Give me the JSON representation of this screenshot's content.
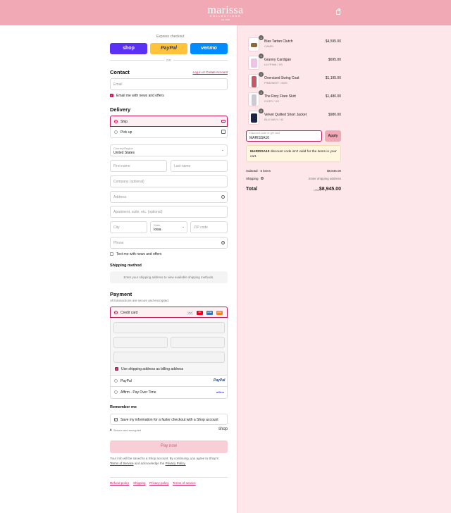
{
  "header": {
    "brand": "marissa",
    "brand_sub": "COLLECTIONS",
    "brand_est": "est. 1996",
    "cart_icon": "shopping-bag-icon"
  },
  "express": {
    "title": "Express checkout",
    "shop": "shop",
    "paypal": "PayPal",
    "venmo": "venmo",
    "or": "OR"
  },
  "contact": {
    "title": "Contact",
    "login_link": "Log in or Create Account",
    "email_placeholder": "Email",
    "newsletter": "Email me with news and offers"
  },
  "delivery": {
    "title": "Delivery",
    "ship": "Ship",
    "pickup": "Pick up",
    "country_label": "Country/Region",
    "country_value": "United States",
    "first_name": "First name",
    "last_name": "Last name",
    "company": "Company (optional)",
    "address": "Address",
    "apartment": "Apartment, suite, etc. (optional)",
    "city": "City",
    "state_label": "State",
    "state_value": "Iowa",
    "zip": "ZIP code",
    "phone": "Phone",
    "text_offers": "Text me with news and offers"
  },
  "shipping_method": {
    "title": "Shipping method",
    "placeholder": "Enter your shipping address to view available shipping methods."
  },
  "payment": {
    "title": "Payment",
    "subtitle": "All transactions are secure and encrypted.",
    "credit_card": "Credit card",
    "billing_same": "Use shipping address as billing address",
    "paypal": "PayPal",
    "affirm": "Affirm - Pay Over Time",
    "card_brands": [
      "VISA",
      "MC",
      "AMEX",
      "DISC"
    ]
  },
  "remember": {
    "title": "Remember me",
    "save_info": "Save my information for a faster checkout with a Shop account",
    "secure": "Secure and encrypted",
    "shop": "shop"
  },
  "pay_button": "Pay now",
  "legal": {
    "text1": "Your info will be saved to a Shop account. By continuing, you agree to Shop's",
    "terms": "Terms of Service",
    "text2": "and acknowledge the",
    "privacy": "Privacy Policy."
  },
  "footer_links": [
    "Refund policy",
    "Shipping",
    "Privacy policy",
    "Terms of service"
  ],
  "cart": {
    "items": [
      {
        "qty": "1",
        "name": "Bias Tartan Clutch",
        "variant": "CAMEL",
        "price": "$4,595.00",
        "color": "#8a6a3a"
      },
      {
        "qty": "1",
        "name": "Granny Cardigan",
        "variant": "LILYPINK / XS",
        "price": "$695.00",
        "color": "#e9c6e3"
      },
      {
        "qty": "1",
        "name": "Oversized Swing Coat",
        "variant": "PINK/NEST / 50/S",
        "price": "$1,195.00",
        "color": "#c25a6a"
      },
      {
        "qty": "1",
        "name": "The Rory Flare Skirt",
        "variant": "IVORY / XS",
        "price": "$1,480.00",
        "color": "#cfc9d4"
      },
      {
        "qty": "2",
        "name": "Velvet Quilted Short Jacket",
        "variant": "BLU NAVY / 42",
        "price": "$980.00",
        "color": "#1c2440"
      }
    ],
    "discount_label": "Discount code or gift card",
    "discount_value": "MARISSA10",
    "apply": "Apply",
    "discount_code": "MARISSA10",
    "discount_error": "discount code isn't valid for the items in your cart.",
    "subtotal_label": "Subtotal · 5 items",
    "subtotal_value": "$8,845.00",
    "shipping_label": "Shipping",
    "shipping_value": "Enter shipping address",
    "total_label": "Total",
    "currency": "USD",
    "total_value": "$8,945.00"
  },
  "colors": {
    "brand_pink": "#f2a9b6",
    "accent": "#c2185b",
    "panel": "#fde7ea",
    "shop_purple": "#5a31f4",
    "paypal_yellow": "#ffc439",
    "venmo_blue": "#008cff"
  }
}
